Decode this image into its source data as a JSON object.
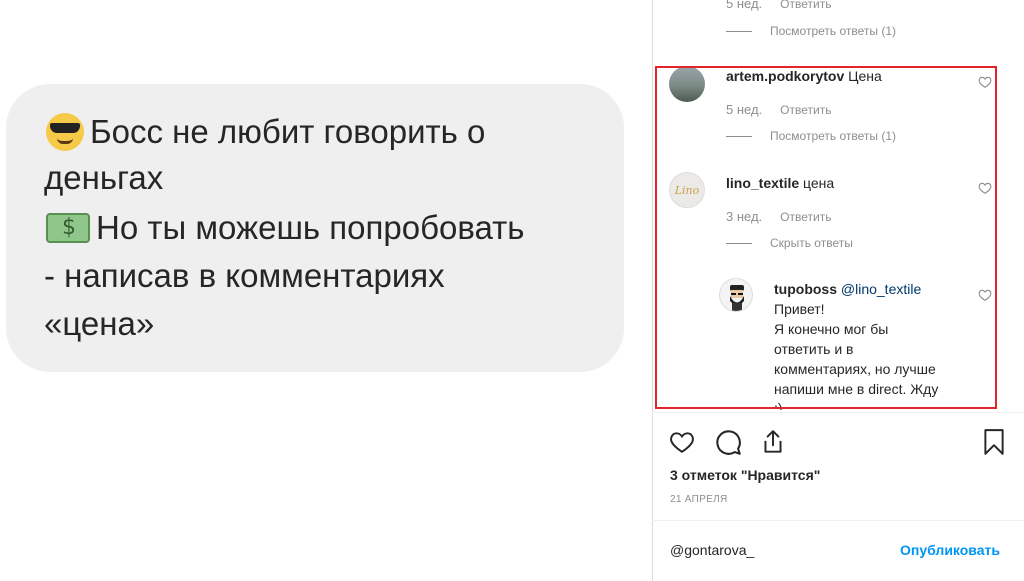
{
  "post_image": {
    "lines": [
      "Босс не любит говорить о",
      "деньгах",
      "Но ты можешь попробовать",
      "- написав в комментариях",
      "«цена»"
    ]
  },
  "comments_panel": {
    "top_partial": {
      "time": "5 нед.",
      "reply_label": "Ответить",
      "view_replies": "Посмотреть ответы (1)"
    },
    "comments": [
      {
        "username": "artem.podkorytov",
        "text": "Цена",
        "time": "5 нед.",
        "reply_label": "Ответить",
        "replies_toggle": "Посмотреть ответы (1)"
      },
      {
        "username": "lino_textile",
        "text": "цена",
        "time": "3 нед.",
        "reply_label": "Ответить",
        "replies_toggle": "Скрыть ответы",
        "avatar_text": "Lino"
      }
    ],
    "reply": {
      "username": "tupoboss",
      "mention": "@lino_textile",
      "lines": [
        "Привет!",
        "Я конечно мог бы",
        "ответить и в",
        "комментариях, но лучше",
        "напиши мне в direct. Жду",
        ":)"
      ]
    }
  },
  "footer": {
    "likes": "3 отметок \"Нравится\"",
    "date": "21 АПРЕЛЯ",
    "comment_input_value": "@gontarova_",
    "publish_label": "Опубликовать"
  },
  "colors": {
    "highlight": "#e3242b",
    "publish": "#0095f6",
    "muted": "#8e8e8e",
    "bubble": "#efefef"
  }
}
